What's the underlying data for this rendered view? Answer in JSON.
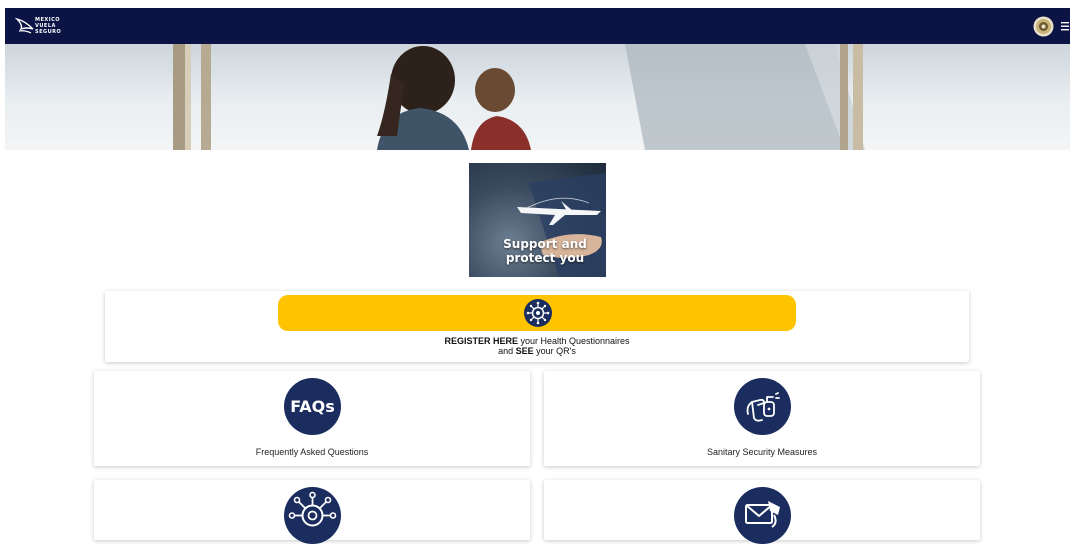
{
  "header": {
    "logo": {
      "icon": "mexico-vuela-seguro-logo",
      "lines": [
        "MEXICO",
        "VUELA",
        "SEGURO"
      ]
    },
    "right_icons": [
      "seal-icon",
      "hamburger-menu-icon"
    ],
    "background_color": "#0c1446"
  },
  "hero": {
    "image": "parent-and-child-at-airport-window"
  },
  "promo": {
    "image": "hand-holding-airplane",
    "caption_line1": "Support and",
    "caption_line2": "protect you"
  },
  "register": {
    "button_icon": "virus-icon",
    "button_color": "#ffc400",
    "strong_1": "REGISTER HERE",
    "text_1": " your Health Questionnaires",
    "text_2a": "and ",
    "strong_2": "SEE",
    "text_2b": " your QR's"
  },
  "tiles": [
    {
      "icon": "faqs-icon",
      "icon_text": "FAQs",
      "label": "Frequently Asked Questions"
    },
    {
      "icon": "hand-sanitizer-icon",
      "label": "Sanitary Security Measures"
    },
    {
      "icon": "virus-icon",
      "label": ""
    },
    {
      "icon": "envelope-icon",
      "label": ""
    }
  ],
  "colors": {
    "navy": "#0c1446",
    "icon_circle": "#1b2d5e",
    "yellow": "#ffc400"
  }
}
